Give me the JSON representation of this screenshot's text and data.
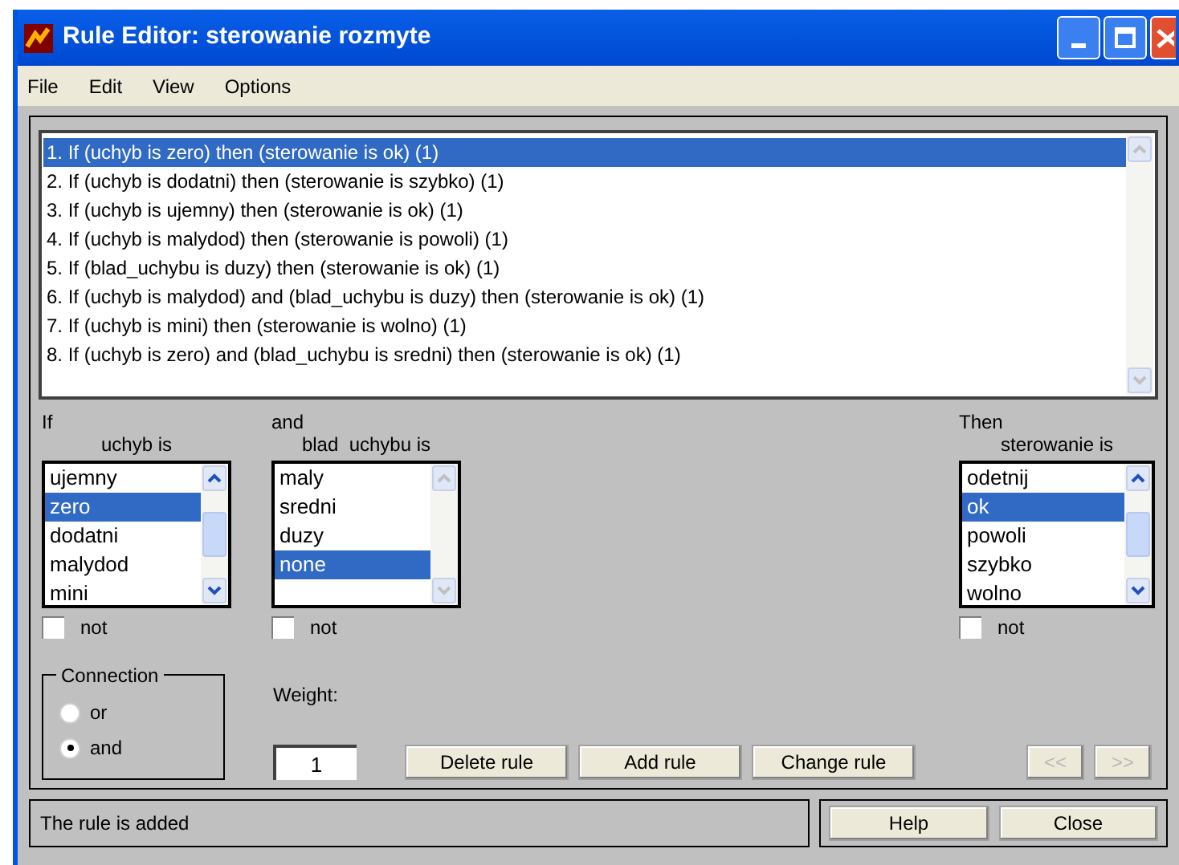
{
  "window": {
    "title": "Rule Editor: sterowanie rozmyte"
  },
  "menu": [
    "File",
    "Edit",
    "View",
    "Options"
  ],
  "rules": [
    {
      "text": "1. If (uchyb is zero) then (sterowanie is ok) (1)",
      "selected": true
    },
    {
      "text": "2. If (uchyb is dodatni) then (sterowanie is szybko) (1)",
      "selected": false
    },
    {
      "text": "3. If (uchyb is ujemny) then (sterowanie is ok) (1)",
      "selected": false
    },
    {
      "text": "4. If (uchyb is malydod) then (sterowanie is powoli) (1)",
      "selected": false
    },
    {
      "text": "5. If (blad_uchybu is duzy) then (sterowanie is ok) (1)",
      "selected": false
    },
    {
      "text": "6. If (uchyb is malydod) and (blad_uchybu is duzy) then (sterowanie is ok) (1)",
      "selected": false
    },
    {
      "text": "7. If (uchyb is mini) then (sterowanie is wolno) (1)",
      "selected": false
    },
    {
      "text": "8. If (uchyb is zero) and (blad_uchybu is sredni) then (sterowanie is ok) (1)",
      "selected": false
    }
  ],
  "antecedents": [
    {
      "lead": "If",
      "header": "uchyb is",
      "items": [
        {
          "label": "ujemny",
          "selected": false
        },
        {
          "label": "zero",
          "selected": true
        },
        {
          "label": "dodatni",
          "selected": false
        },
        {
          "label": "malydod",
          "selected": false
        },
        {
          "label": "mini",
          "selected": false
        }
      ],
      "not": {
        "label": "not",
        "checked": false
      }
    },
    {
      "lead": "and",
      "header": "blad  uchybu is",
      "items": [
        {
          "label": "maly",
          "selected": false
        },
        {
          "label": "sredni",
          "selected": false
        },
        {
          "label": "duzy",
          "selected": false
        },
        {
          "label": "none",
          "selected": true
        }
      ],
      "not": {
        "label": "not",
        "checked": false
      }
    }
  ],
  "consequent": {
    "lead": "Then",
    "header": "sterowanie is",
    "items": [
      {
        "label": "odetnij",
        "selected": false
      },
      {
        "label": "ok",
        "selected": true
      },
      {
        "label": "powoli",
        "selected": false
      },
      {
        "label": "szybko",
        "selected": false
      },
      {
        "label": "wolno",
        "selected": false
      }
    ],
    "not": {
      "label": "not",
      "checked": false
    }
  },
  "connection": {
    "title": "Connection",
    "options": [
      {
        "label": "or",
        "selected": false
      },
      {
        "label": "and",
        "selected": true
      }
    ]
  },
  "weight": {
    "label": "Weight:",
    "value": "1"
  },
  "actions": [
    "Delete rule",
    "Add rule",
    "Change rule"
  ],
  "nav": [
    {
      "label": "<<",
      "disabled": true
    },
    {
      "label": ">>",
      "disabled": true
    }
  ],
  "status": "The rule is added",
  "footer_buttons": [
    "Help",
    "Close"
  ]
}
